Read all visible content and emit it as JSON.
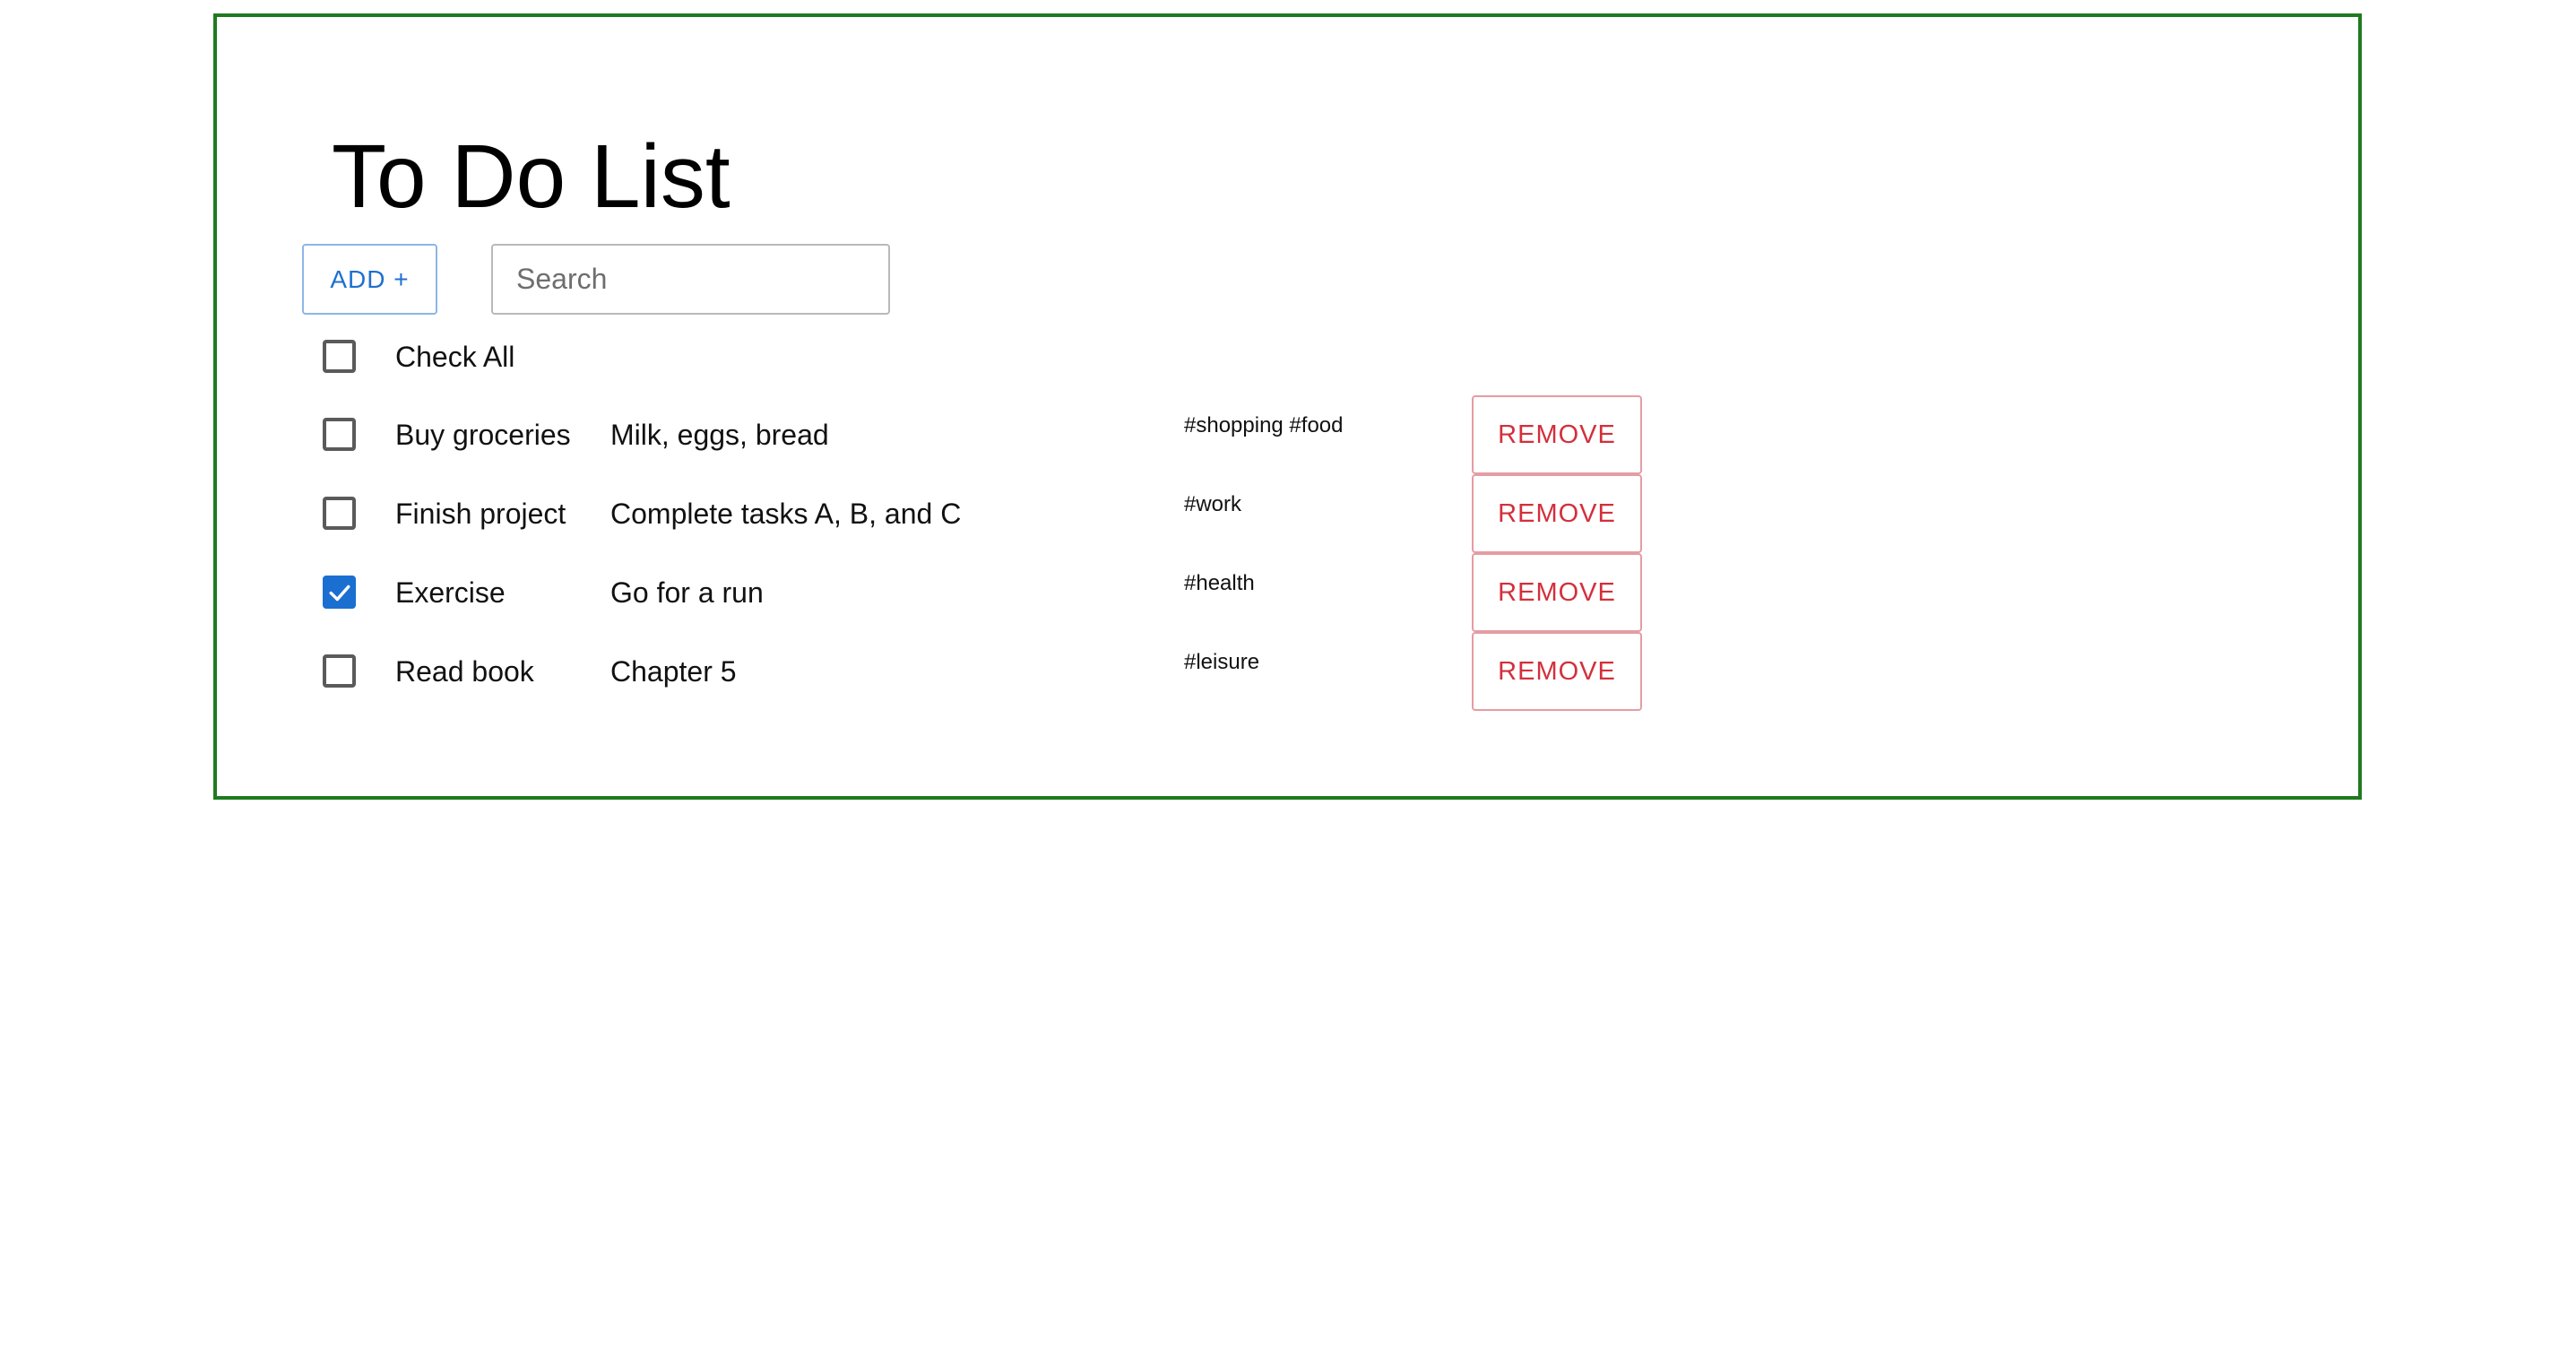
{
  "page": {
    "title": "To Do List"
  },
  "toolbar": {
    "add_label": "ADD +",
    "search_placeholder": "Search",
    "search_value": ""
  },
  "check_all": {
    "label": "Check All",
    "checked": false
  },
  "todos": [
    {
      "title": "Buy groceries",
      "description": "Milk, eggs, bread",
      "tags": "#shopping #food",
      "checked": false,
      "remove_label": "REMOVE"
    },
    {
      "title": "Finish project",
      "description": "Complete tasks A, B, and C",
      "tags": "#work",
      "checked": false,
      "remove_label": "REMOVE"
    },
    {
      "title": "Exercise",
      "description": "Go for a run",
      "tags": "#health",
      "checked": true,
      "remove_label": "REMOVE"
    },
    {
      "title": "Read book",
      "description": "Chapter 5",
      "tags": "#leisure",
      "checked": false,
      "remove_label": "REMOVE"
    }
  ],
  "colors": {
    "frame_border": "#1f7a1f",
    "primary": "#1a6fd1",
    "danger": "#d32f3c"
  },
  "icons": {
    "checked_box": "checkmark-icon"
  }
}
